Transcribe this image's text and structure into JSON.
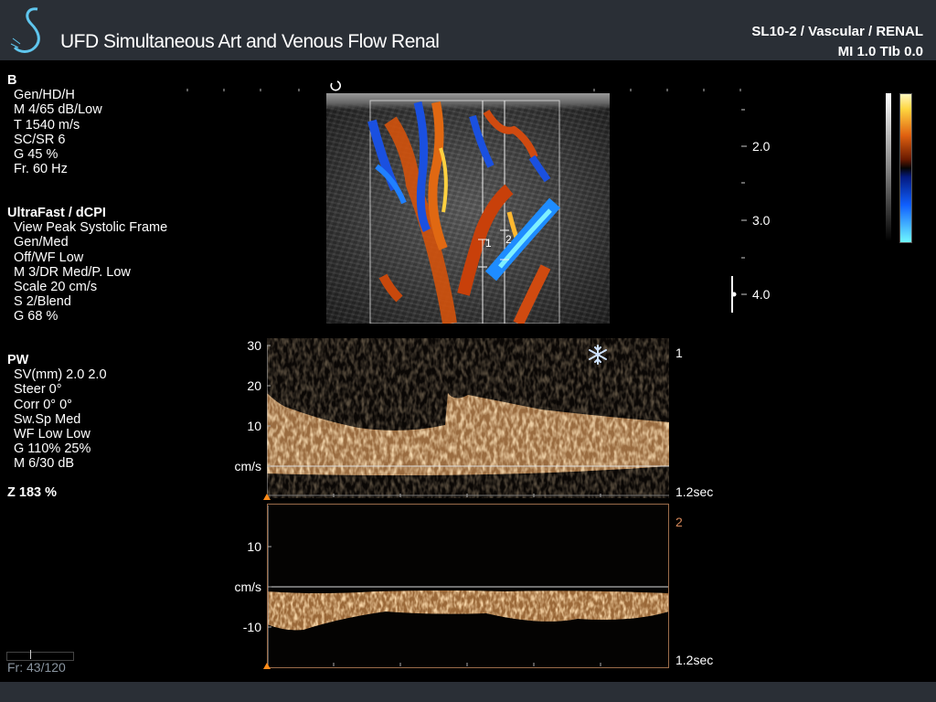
{
  "header": {
    "title": "UFD Simultaneous Art and Venous Flow Renal",
    "probe": "SL10-2 / Vascular / RENAL",
    "mi_tib": "MI 1.0  TIb 0.0"
  },
  "b_mode": {
    "label": "B",
    "lines": [
      "Gen/HD/H",
      "M 4/65 dB/Low",
      "T 1540 m/s",
      "SC/SR 6",
      "G 45 %",
      "Fr. 60 Hz"
    ]
  },
  "color_mode": {
    "label": "UltraFast / dCPI",
    "lines": [
      "View Peak Systolic Frame",
      "Gen/Med",
      "Off/WF Low",
      "M 3/DR Med/P. Low",
      "Scale 20 cm/s",
      "S 2/Blend",
      "G 68 %"
    ]
  },
  "pw_mode": {
    "label": "PW",
    "lines": [
      "SV(mm) 2.0 2.0",
      "Steer 0°",
      "Corr 0° 0°",
      "Sw.Sp Med",
      "WF Low Low",
      "G 110% 25%",
      "M 6/30 dB"
    ]
  },
  "zoom": "Z  183  %",
  "depth_labels": [
    "2.0",
    "3.0",
    "4.0"
  ],
  "gate_labels": [
    "1",
    "2"
  ],
  "spectrum1": {
    "gate": "1",
    "axis": [
      "30",
      "20",
      "10",
      "cm/s"
    ],
    "time": "1.2sec",
    "freeze_icon": "snowflake-icon"
  },
  "spectrum2": {
    "gate": "2",
    "axis": [
      "10",
      "cm/s",
      "-10"
    ],
    "time": "1.2sec"
  },
  "frame": "Fr: 43/120",
  "colors": {
    "header_bg": "#2a2f36",
    "spectrum_color": "#e8b070",
    "gate2_accent": "#d4875a"
  }
}
